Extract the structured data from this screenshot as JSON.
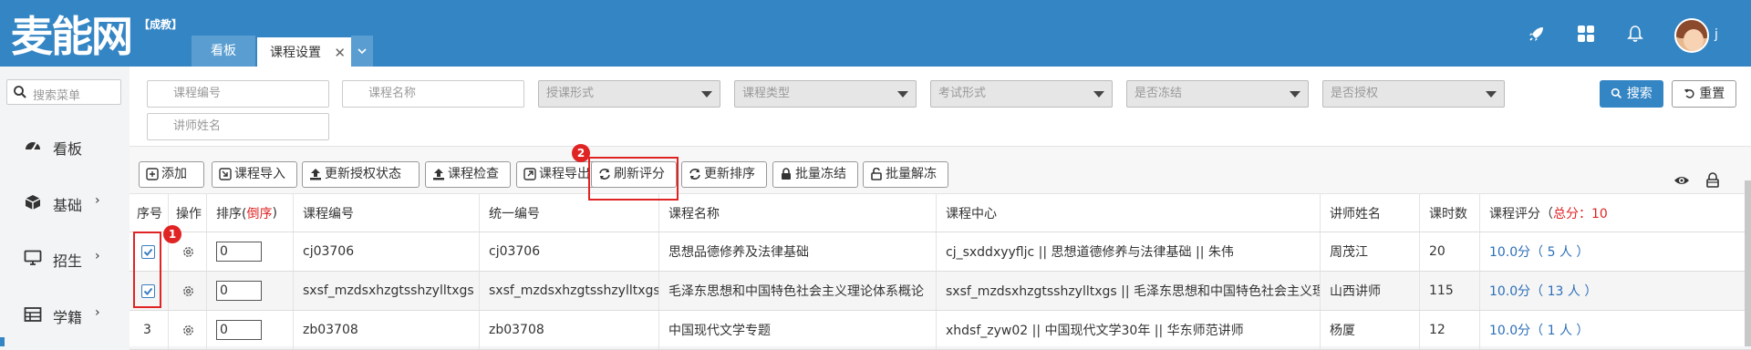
{
  "header": {
    "logo": "麦能网",
    "logo_sub": "【成教】",
    "tabs": [
      {
        "label": "看板",
        "active": false
      },
      {
        "label": "课程设置",
        "active": true,
        "close": "✕"
      }
    ],
    "tab_dropdown": "⌄",
    "user_name": "j",
    "icons": [
      "rocket-icon",
      "grid-icon",
      "bell-icon"
    ],
    "colors": {
      "bar": "#3485c4",
      "inactive_tab": "#5a9ed1"
    }
  },
  "sidebar": {
    "search_placeholder": "搜索菜单",
    "items": [
      {
        "label": "看板",
        "icon": "dashboard-icon",
        "arrow": ""
      },
      {
        "label": "基础",
        "icon": "cube-icon",
        "arrow": "›"
      },
      {
        "label": "招生",
        "icon": "monitor-icon",
        "arrow": "›"
      },
      {
        "label": "学籍",
        "icon": "table-icon",
        "arrow": "›"
      }
    ]
  },
  "filters": {
    "course_code": "课程编号",
    "course_name": "课程名称",
    "teaching_form": "授课形式",
    "course_type": "课程类型",
    "exam_form": "考试形式",
    "frozen": "是否冻结",
    "authorized": "是否授权",
    "teacher_name": "讲师姓名",
    "search_label": "搜索",
    "reset_label": "重置"
  },
  "toolbar": {
    "buttons": [
      {
        "label": "添加",
        "icon": "add-icon"
      },
      {
        "label": "课程导入",
        "icon": "import-icon"
      },
      {
        "label": "更新授权状态",
        "icon": "upload-icon"
      },
      {
        "label": "课程检查",
        "icon": "upload-icon"
      },
      {
        "label": "课程导出",
        "icon": "export-icon"
      },
      {
        "label": "刷新评分",
        "icon": "refresh-icon"
      },
      {
        "label": "更新排序",
        "icon": "refresh-icon"
      },
      {
        "label": "批量冻结",
        "icon": "lock-icon"
      },
      {
        "label": "批量解冻",
        "icon": "unlock-icon"
      }
    ],
    "badge1": "1",
    "badge2": "2"
  },
  "table": {
    "headers": {
      "seq": "序号",
      "op": "操作",
      "sort": "排序(",
      "sort_red": "倒序",
      "sort_end": ")",
      "code": "课程编号",
      "unified": "统一编号",
      "name": "课程名称",
      "center": "课程中心",
      "teacher": "讲师姓名",
      "hours": "课时数",
      "rating": "课程评分（",
      "rating_total": "总分：10"
    },
    "rows": [
      {
        "seq": "",
        "checked": true,
        "sort": "0",
        "code": "cj03706",
        "unified": "cj03706",
        "name": "思想品德修养及法律基础",
        "center": "cj_sxddxyyfljc || 思想道德修养与法律基础 || 朱伟",
        "teacher": "周茂江",
        "hours": "20",
        "rating": "10.0分（ 5 人 ）"
      },
      {
        "seq": "",
        "checked": true,
        "sort": "0",
        "code": "sxsf_mzdsxhzgtsshzylltxgs",
        "unified": "sxsf_mzdsxhzgtsshzylltxgs",
        "name": "毛泽东思想和中国特色社会主义理论体系概论",
        "center": "sxsf_mzdsxhzgtsshzylltxgs || 毛泽东思想和中国特色社会主义理论体系概论 || 山西讲师",
        "teacher": "山西讲师",
        "hours": "115",
        "rating": "10.0分（ 13 人 ）"
      },
      {
        "seq": "3",
        "checked": false,
        "sort": "0",
        "code": "zb03708",
        "unified": "zb03708",
        "name": "中国现代文学专题",
        "center": "xhdsf_zyw02 || 中国现代文学30年 || 华东师范讲师",
        "teacher": "杨厦",
        "hours": "12",
        "rating": "10.0分（ 1 人 ）"
      }
    ]
  }
}
